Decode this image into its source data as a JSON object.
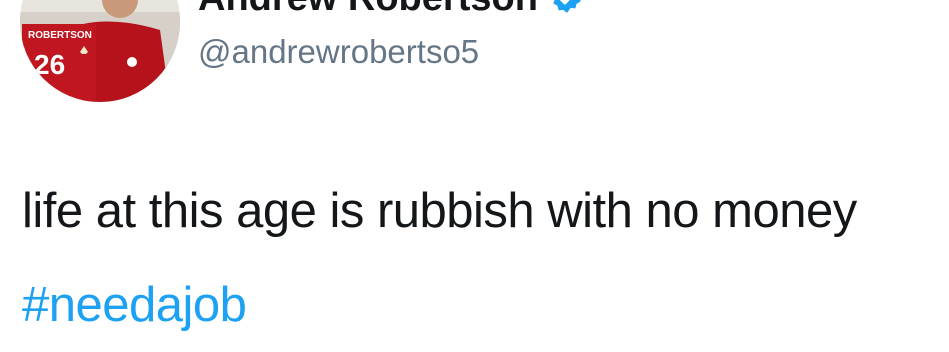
{
  "tweet": {
    "author": {
      "display_name": "Andrew Robertson",
      "handle": "@andrewrobertso5",
      "verified": true,
      "avatar": {
        "shirt_name": "ROBERTSON",
        "shirt_number": "26",
        "shirt_color": "#b5121b"
      },
      "badge_color": "#1da1f2"
    },
    "text": "life at this age is rubbish with no money",
    "hashtag": "#needajob"
  }
}
